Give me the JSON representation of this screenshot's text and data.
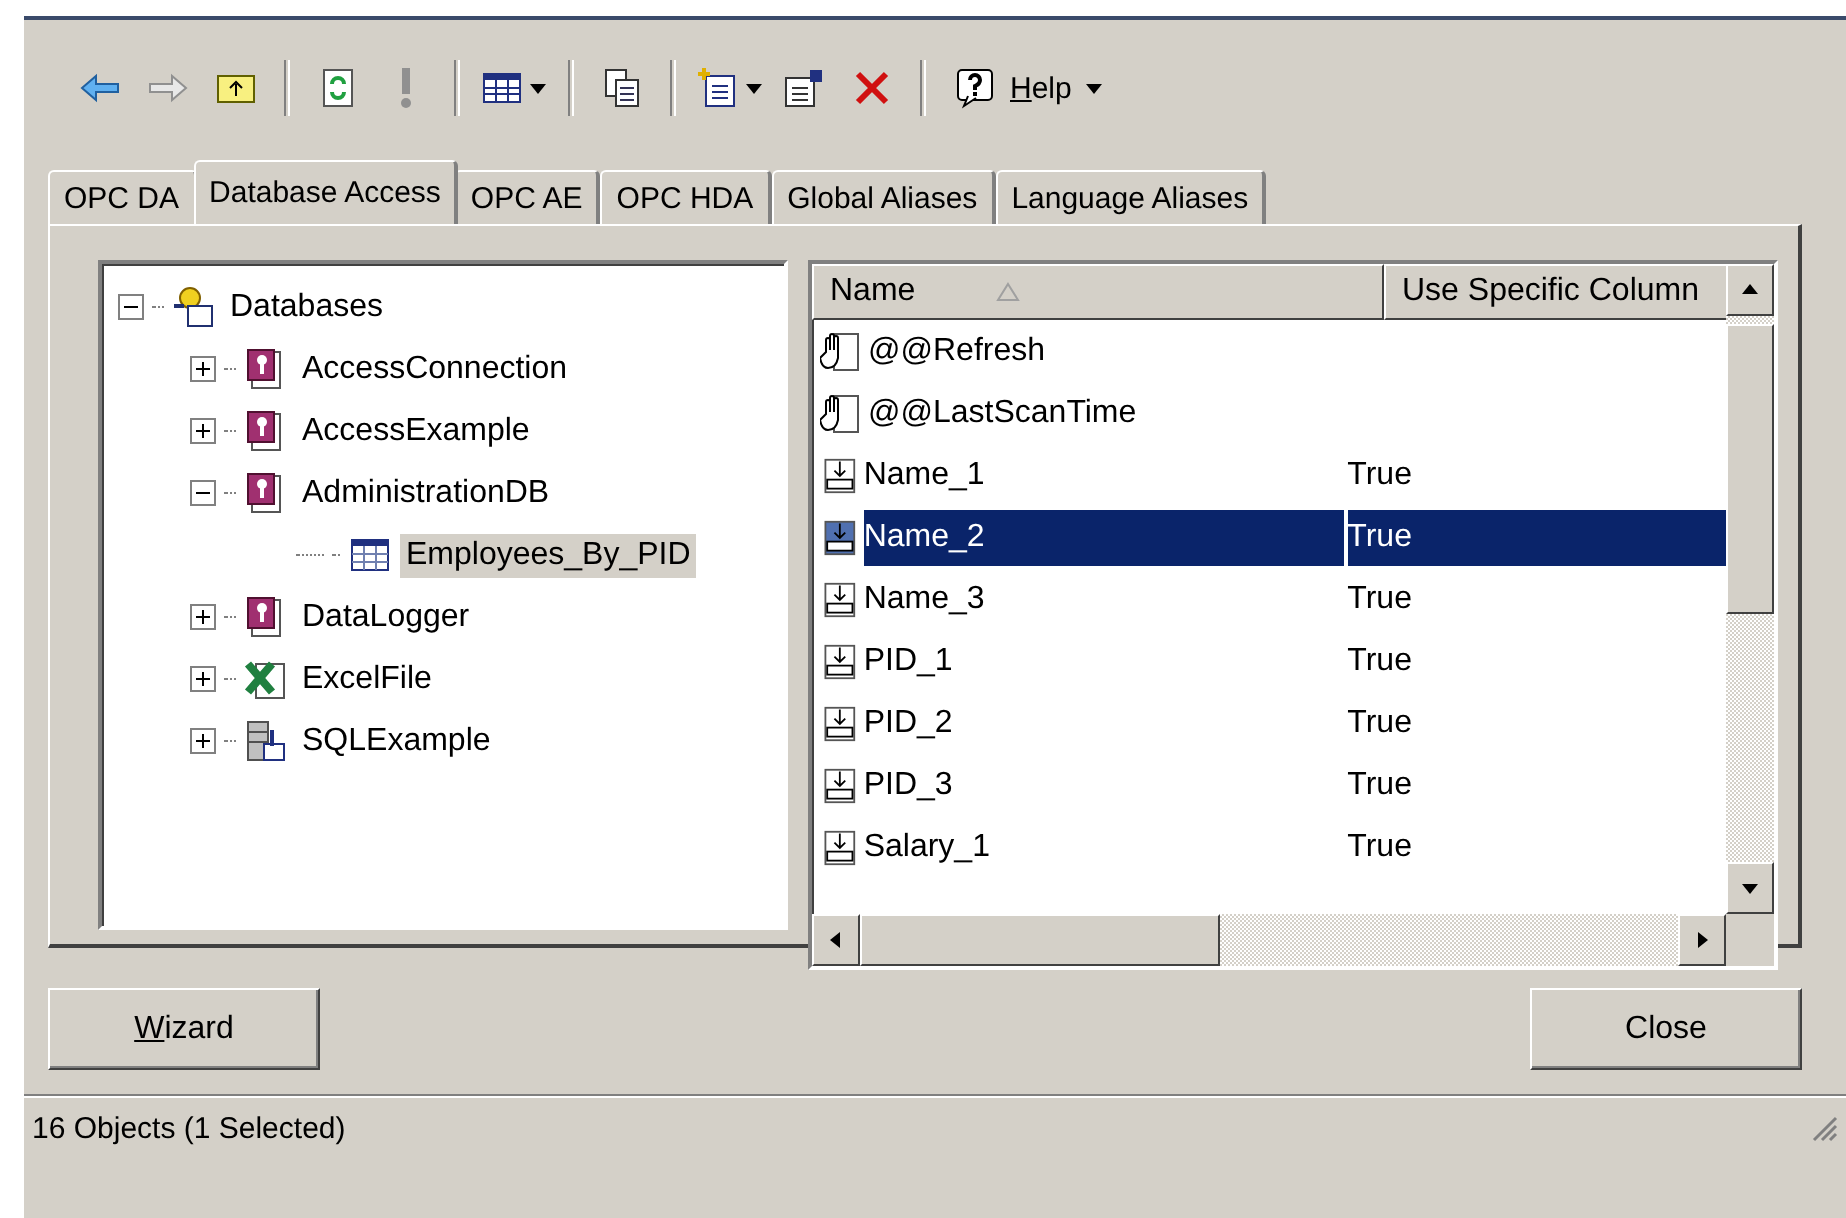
{
  "toolbar": {
    "help_label": "Help"
  },
  "tabs": [
    {
      "label": "OPC DA",
      "selected": false
    },
    {
      "label": "Database Access",
      "selected": true
    },
    {
      "label": "OPC AE",
      "selected": false
    },
    {
      "label": "OPC HDA",
      "selected": false
    },
    {
      "label": "Global Aliases",
      "selected": false
    },
    {
      "label": "Language Aliases",
      "selected": false
    }
  ],
  "tree": [
    {
      "label": "Databases",
      "kind": "databases",
      "expanded": true,
      "selected": false,
      "children": [
        {
          "label": "AccessConnection",
          "kind": "access",
          "expanded": false,
          "selected": false
        },
        {
          "label": "AccessExample",
          "kind": "access",
          "expanded": false,
          "selected": false
        },
        {
          "label": "AdministrationDB",
          "kind": "access",
          "expanded": true,
          "selected": false,
          "children": [
            {
              "label": "Employees_By_PID",
              "kind": "table",
              "selected": true
            }
          ]
        },
        {
          "label": "DataLogger",
          "kind": "access",
          "expanded": false,
          "selected": false
        },
        {
          "label": "ExcelFile",
          "kind": "excel",
          "expanded": false,
          "selected": false
        },
        {
          "label": "SQLExample",
          "kind": "sql",
          "expanded": false,
          "selected": false
        }
      ]
    }
  ],
  "list": {
    "columns": [
      {
        "label": "Name",
        "sorted": true
      },
      {
        "label": "Use Specific Column",
        "sorted": false
      }
    ],
    "rows": [
      {
        "name": "@@Refresh",
        "kind": "system",
        "selected": false
      },
      {
        "name": "@@LastScanTime",
        "kind": "system",
        "selected": false
      },
      {
        "name": "Name_1",
        "use_specific_column": "True",
        "kind": "item",
        "selected": false
      },
      {
        "name": "Name_2",
        "use_specific_column": "True",
        "kind": "item",
        "selected": true
      },
      {
        "name": "Name_3",
        "use_specific_column": "True",
        "kind": "item",
        "selected": false
      },
      {
        "name": "PID_1",
        "use_specific_column": "True",
        "kind": "item",
        "selected": false
      },
      {
        "name": "PID_2",
        "use_specific_column": "True",
        "kind": "item",
        "selected": false
      },
      {
        "name": "PID_3",
        "use_specific_column": "True",
        "kind": "item",
        "selected": false
      },
      {
        "name": "Salary_1",
        "use_specific_column": "True",
        "kind": "item",
        "selected": false
      }
    ]
  },
  "buttons": {
    "left": "Wizard",
    "right": "Close"
  },
  "status_bar": "16 Objects (1 Selected)"
}
